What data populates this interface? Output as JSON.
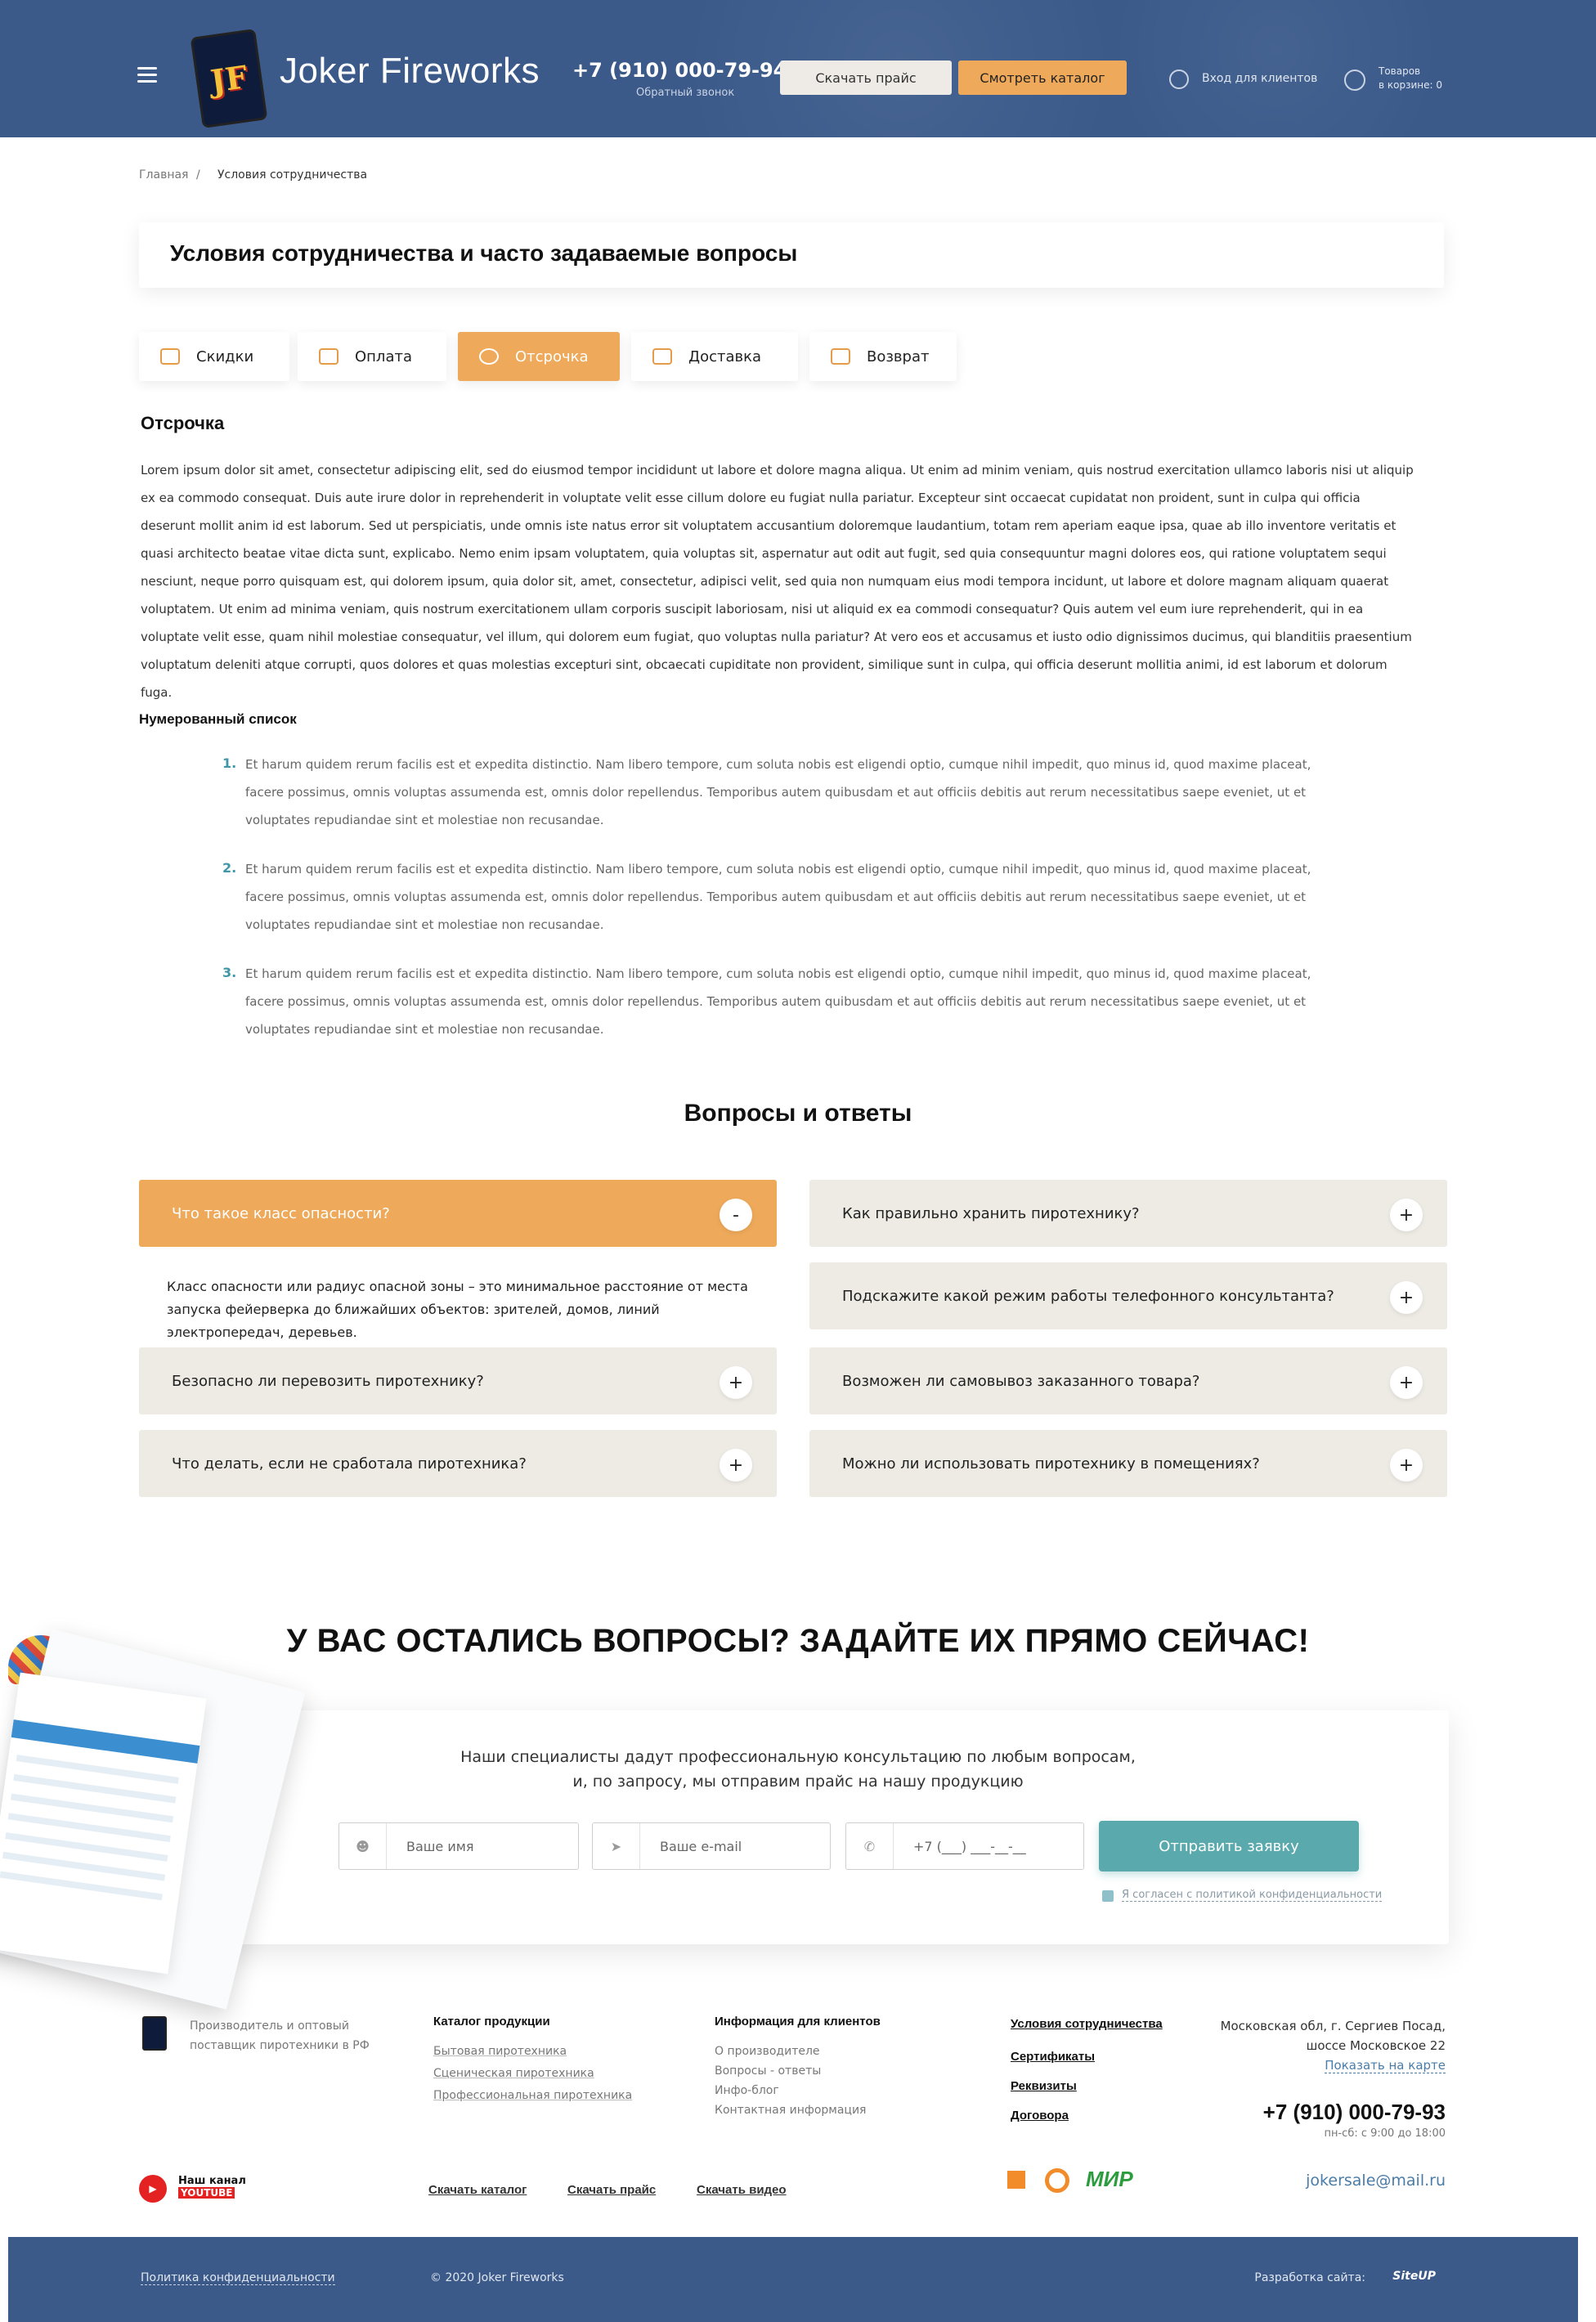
{
  "header": {
    "brand": "Joker Fireworks",
    "phone": "+7 (910) 000-79-94",
    "callback": "Обратный звонок",
    "download_price": "Скачать прайс",
    "view_catalog": "Смотреть каталог",
    "login": "Вход для клиентов",
    "cart_line1": "Товаров",
    "cart_line2": "в корзине: 0"
  },
  "breadcrumb": {
    "home": "Главная",
    "sep": "/",
    "current": "Условия сотрудничества"
  },
  "page_title": "Условия сотрудничества и часто задаваемые вопросы",
  "tabs": [
    {
      "label": "Скидки",
      "icon": "tag-icon"
    },
    {
      "label": "Оплата",
      "icon": "card-icon"
    },
    {
      "label": "Отсрочка",
      "icon": "clock-icon"
    },
    {
      "label": "Доставка",
      "icon": "truck-icon"
    },
    {
      "label": "Возврат",
      "icon": "return-icon"
    }
  ],
  "section_title": "Отсрочка",
  "section_body": "Lorem ipsum dolor sit amet, consectetur adipiscing elit, sed do eiusmod tempor incididunt ut labore et dolore magna aliqua. Ut enim ad minim veniam, quis nostrud exercitation ullamco laboris nisi ut aliquip ex ea commodo consequat. Duis aute irure dolor in reprehenderit in voluptate velit esse cillum dolore eu fugiat nulla pariatur. Excepteur sint occaecat cupidatat non proident, sunt in culpa qui officia deserunt mollit anim id est laborum. Sed ut perspiciatis, unde omnis iste natus error sit voluptatem accusantium doloremque laudantium, totam rem aperiam eaque ipsa, quae ab illo inventore veritatis et quasi architecto beatae vitae dicta sunt, explicabo. Nemo enim ipsam voluptatem, quia voluptas sit, aspernatur aut odit aut fugit, sed quia consequuntur magni dolores eos, qui ratione voluptatem sequi nesciunt, neque porro quisquam est, qui dolorem ipsum, quia dolor sit, amet, consectetur, adipisci velit, sed quia non numquam eius modi tempora incidunt, ut labore et dolore magnam aliquam quaerat voluptatem. Ut enim ad minima veniam, quis nostrum exercitationem ullam corporis suscipit laboriosam, nisi ut aliquid ex ea commodi consequatur? Quis autem vel eum iure reprehenderit, qui in ea voluptate velit esse, quam nihil molestiae consequatur, vel illum, qui dolorem eum fugiat, quo voluptas nulla pariatur? At vero eos et accusamus et iusto odio dignissimos ducimus, qui blanditiis praesentium voluptatum deleniti atque corrupti, quos dolores et quas molestias excepturi sint, obcaecati cupiditate non provident, similique sunt in culpa, qui officia deserunt mollitia animi, id est laborum et dolorum fuga.",
  "list_title": "Нумерованный список",
  "list": [
    {
      "num": "1.",
      "text": "Et harum quidem rerum facilis est et expedita distinctio. Nam libero tempore, cum soluta nobis est eligendi optio, cumque nihil impedit, quo minus id, quod maxime placeat, facere possimus, omnis voluptas assumenda est, omnis dolor repellendus. Temporibus autem quibusdam et aut officiis debitis aut rerum necessitatibus saepe eveniet, ut et voluptates repudiandae sint et molestiae non recusandae."
    },
    {
      "num": "2.",
      "text": "Et harum quidem rerum facilis est et expedita distinctio. Nam libero tempore, cum soluta nobis est eligendi optio, cumque nihil impedit, quo minus id, quod maxime placeat, facere possimus, omnis voluptas assumenda est, omnis dolor repellendus. Temporibus autem quibusdam et aut officiis debitis aut rerum necessitatibus saepe eveniet, ut et voluptates repudiandae sint et molestiae non recusandae."
    },
    {
      "num": "3.",
      "text": "Et harum quidem rerum facilis est et expedita distinctio. Nam libero tempore, cum soluta nobis est eligendi optio, cumque nihil impedit, quo minus id, quod maxime placeat, facere possimus, omnis voluptas assumenda est, omnis dolor repellendus. Temporibus autem quibusdam et aut officiis debitis aut rerum necessitatibus saepe eveniet, ut et voluptates repudiandae sint et molestiae non recusandae."
    }
  ],
  "faq_title": "Вопросы и ответы",
  "faq_left": [
    {
      "q": "Что такое класс опасности?",
      "toggle": "-"
    },
    {
      "q": "Безопасно ли перевозить пиротехнику?",
      "toggle": "+"
    },
    {
      "q": "Что делать, если не сработала пиротехника?",
      "toggle": "+"
    }
  ],
  "faq_answer": "Класс опасности или радиус опасной зоны – это минимальное расстояние от места запуска фейерверка до ближайших объектов: зрителей, домов, линий электропередач, деревьев.",
  "faq_right": [
    {
      "q": "Как правильно хранить пиротехнику?",
      "toggle": "+"
    },
    {
      "q": "Подскажите какой режим работы телефонного консультанта?",
      "toggle": "+"
    },
    {
      "q": "Возможен ли самовывоз заказанного товара?",
      "toggle": "+"
    },
    {
      "q": "Можно ли использовать пиротехнику в помещениях?",
      "toggle": "+"
    }
  ],
  "cta": {
    "title": "У ВАС ОСТАЛИСЬ ВОПРОСЫ? ЗАДАЙТЕ ИХ ПРЯМО СЕЙЧАС!",
    "sub1": "Наши специалисты дадут профессиональную консультацию по любым вопросам,",
    "sub2": "и, по запросу, мы отправим прайс на нашу продукцию",
    "name_ph": "Ваше имя",
    "email_ph": "Ваше e-mail",
    "phone_ph": "+7 (___) ___-__-__",
    "send": "Отправить заявку",
    "agree": "Я согласен с политикой конфиденциальности"
  },
  "footer": {
    "desc": "Производитель и оптовый поставщик пиротехники в РФ",
    "catalog_title": "Каталог продукции",
    "catalog": [
      "Бытовая пиротехника",
      "Сценическая пиротехника",
      "Профессиональная пиротехника"
    ],
    "info_title": "Информация для клиентов",
    "info": [
      "О производителе",
      "Вопросы - ответы",
      "Инфо-блог",
      "Контактная информация"
    ],
    "right_links": [
      "Условия сотрудничества",
      "Сертификаты",
      "Реквизиты",
      "Договора"
    ],
    "addr1": "Московская обл, г. Сергиев Посад,",
    "addr2": "шоссе Московское 22",
    "map": "Показать на карте",
    "phone": "+7 (910) 000-79-93",
    "hours": "пн-сб: с 9:00 до 18:00",
    "email": "jokersale@mail.ru",
    "yt1": "Наш канал",
    "yt2": "YOUTUBE",
    "dl_catalog": "Скачать каталог",
    "dl_price": "Скачать прайс",
    "dl_video": "Скачать видео",
    "mir": "МИР",
    "privacy": "Политика конфиденциальности",
    "copyright": "©  2020 Joker Fireworks",
    "dev": "Разработка сайта:",
    "dev_brand": "SiteUP"
  }
}
